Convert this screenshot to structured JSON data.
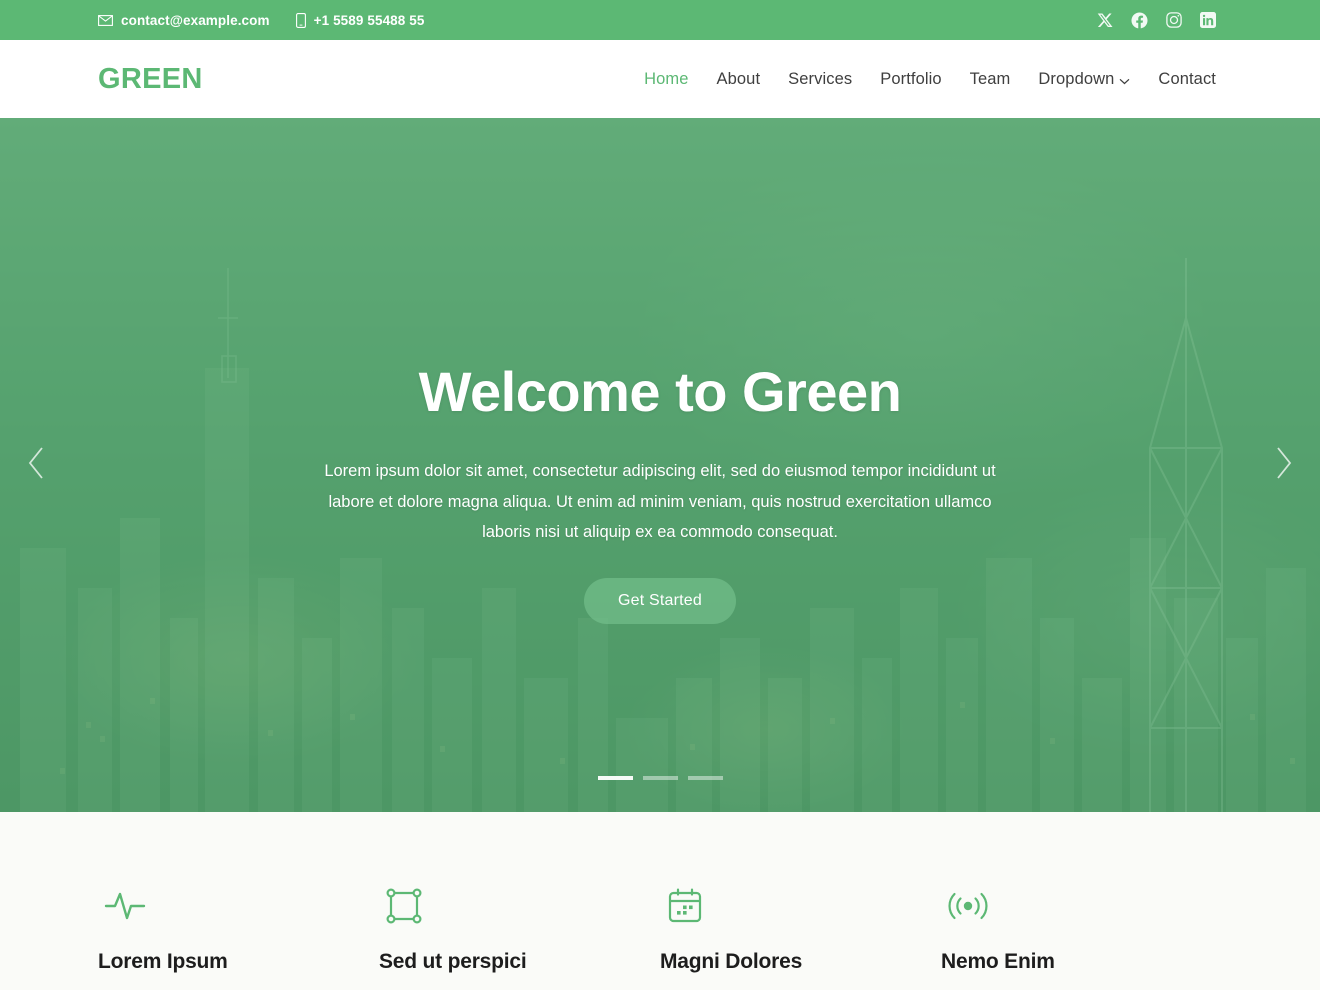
{
  "topbar": {
    "email": "contact@example.com",
    "phone": "+1 5589 55488 55",
    "email_icon": "envelope-icon",
    "phone_icon": "mobile-phone-icon",
    "background_color": "#5cb874",
    "socials": [
      {
        "name": "twitter-x-icon",
        "label": "X"
      },
      {
        "name": "facebook-icon",
        "label": "Facebook"
      },
      {
        "name": "instagram-icon",
        "label": "Instagram"
      },
      {
        "name": "linkedin-icon",
        "label": "LinkedIn"
      }
    ]
  },
  "header": {
    "logo": "GREEN",
    "accent_color": "#5cb874",
    "nav": [
      {
        "label": "Home",
        "active": true,
        "dropdown": false
      },
      {
        "label": "About",
        "active": false,
        "dropdown": false
      },
      {
        "label": "Services",
        "active": false,
        "dropdown": false
      },
      {
        "label": "Portfolio",
        "active": false,
        "dropdown": false
      },
      {
        "label": "Team",
        "active": false,
        "dropdown": false
      },
      {
        "label": "Dropdown",
        "active": false,
        "dropdown": true
      },
      {
        "label": "Contact",
        "active": false,
        "dropdown": false
      }
    ]
  },
  "hero": {
    "title": "Welcome to Green",
    "text": "Lorem ipsum dolor sit amet, consectetur adipiscing elit, sed do eiusmod tempor incididunt ut labore et dolore magna aliqua. Ut enim ad minim veniam, quis nostrud exercitation ullamco laboris nisi ut aliquip ex ea commodo consequat.",
    "button_label": "Get Started",
    "prev_icon": "chevron-left-icon",
    "next_icon": "chevron-right-icon",
    "slides": [
      {
        "active": true
      },
      {
        "active": false
      },
      {
        "active": false
      }
    ]
  },
  "features": [
    {
      "title": "Lorem Ipsum",
      "icon": "activity-pulse-icon"
    },
    {
      "title": "Sed ut perspici",
      "icon": "bounding-box-icon"
    },
    {
      "title": "Magni Dolores",
      "icon": "calendar-icon"
    },
    {
      "title": "Nemo Enim",
      "icon": "broadcast-icon"
    }
  ]
}
